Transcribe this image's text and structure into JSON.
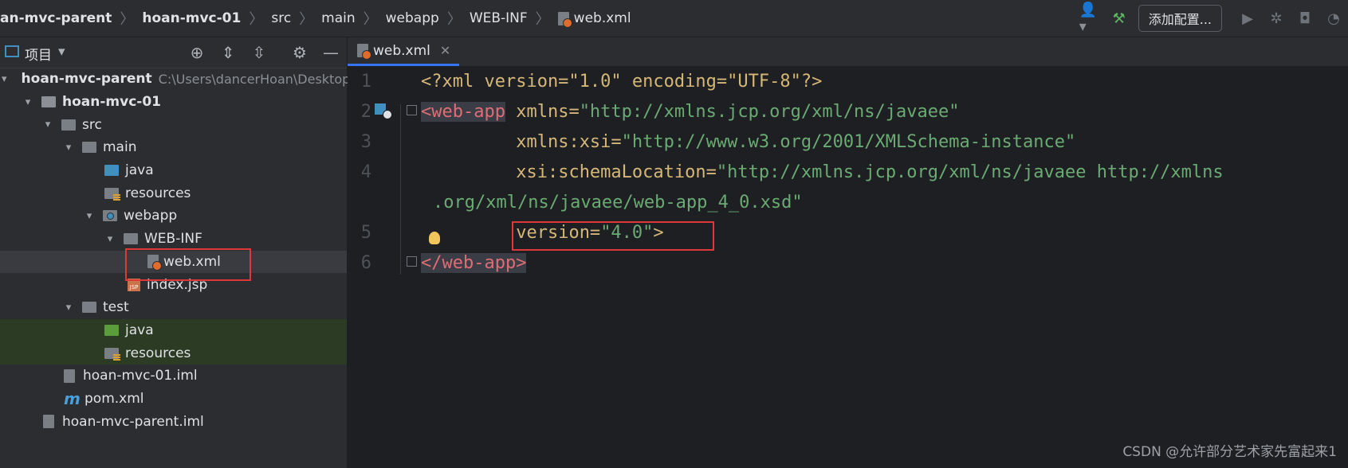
{
  "breadcrumb": {
    "items": [
      "an-mvc-parent",
      "hoan-mvc-01",
      "src",
      "main",
      "webapp",
      "WEB-INF",
      "web.xml"
    ]
  },
  "toolbar": {
    "add_config_label": "添加配置...",
    "icons": [
      "user-icon",
      "hammer-icon",
      "run-icon",
      "debug-icon",
      "coverage-icon",
      "profile-icon"
    ]
  },
  "project_panel": {
    "title": "项目",
    "tree": [
      {
        "label": "hoan-mvc-parent",
        "hint": "C:\\Users\\dancerHoan\\Desktop\\",
        "type": "module"
      },
      {
        "label": "hoan-mvc-01",
        "type": "module"
      },
      {
        "label": "src",
        "type": "folder"
      },
      {
        "label": "main",
        "type": "folder"
      },
      {
        "label": "java",
        "type": "source"
      },
      {
        "label": "resources",
        "type": "resources"
      },
      {
        "label": "webapp",
        "type": "web"
      },
      {
        "label": "WEB-INF",
        "type": "folder"
      },
      {
        "label": "web.xml",
        "type": "xml"
      },
      {
        "label": "index.jsp",
        "type": "jsp"
      },
      {
        "label": "test",
        "type": "folder"
      },
      {
        "label": "java",
        "type": "test-source"
      },
      {
        "label": "resources",
        "type": "test-resources"
      },
      {
        "label": "hoan-mvc-01.iml",
        "type": "iml"
      },
      {
        "label": "pom.xml",
        "type": "maven"
      },
      {
        "label": "hoan-mvc-parent.iml",
        "type": "iml"
      }
    ]
  },
  "editor": {
    "tab_label": "web.xml",
    "line_numbers": [
      "1",
      "2",
      "3",
      "4",
      "5",
      "6"
    ],
    "lines": {
      "l1_pi": "<?xml version=\"1.0\" encoding=\"UTF-8\"?>",
      "l2_open": "<",
      "l2_tag": "web-app",
      "l2_attr": " xmlns=",
      "l2_val": "\"http://xmlns.jcp.org/xml/ns/javaee\"",
      "l3_attr": "xmlns:xsi=",
      "l3_val": "\"http://www.w3.org/2001/XMLSchema-instance\"",
      "l4_attr": "xsi:schemaLocation=",
      "l4_val": "\"http://xmlns.jcp.org/xml/ns/javaee http://xmlns",
      "l4b_val": ".org/xml/ns/javaee/web-app_4_0.xsd\"",
      "l5_attr": "version=",
      "l5_val": "\"4.0\"",
      "l5_close": ">",
      "l6_open": "</",
      "l6_tag": "web-app",
      "l6_close": ">"
    }
  },
  "watermark": "CSDN @允许部分艺术家先富起来1"
}
